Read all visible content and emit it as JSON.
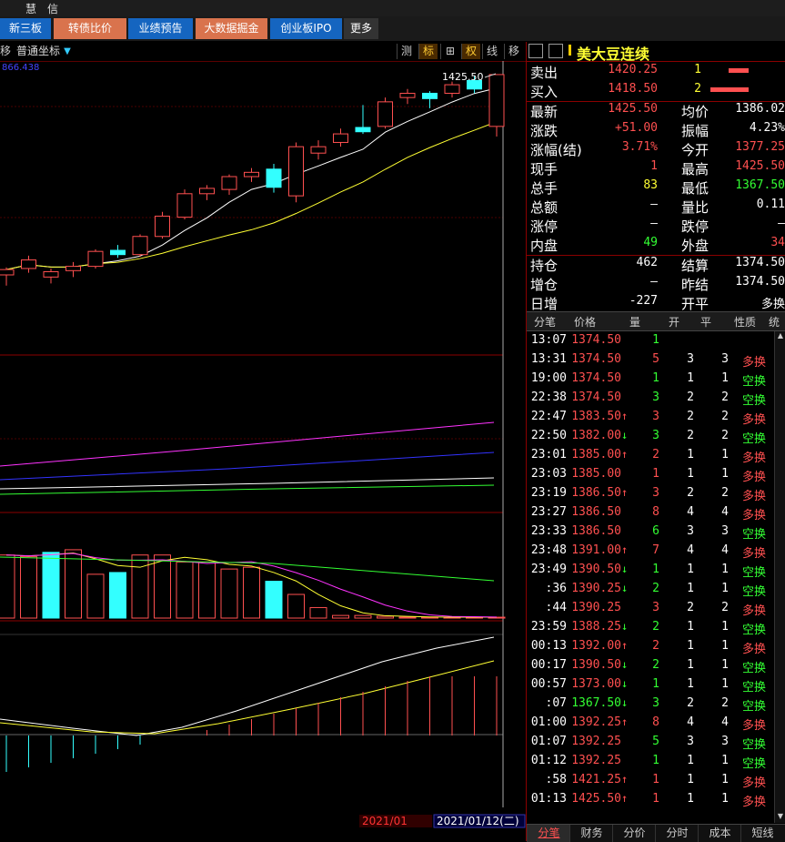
{
  "titlebar": {
    "left": "",
    "app_name_1": "慧",
    "app_name_2": "信"
  },
  "nav": {
    "tabs": [
      {
        "label": "新三板",
        "bg": "#1565c0"
      },
      {
        "label": "转债比价",
        "bg": "#d9734d"
      },
      {
        "label": "业绩预告",
        "bg": "#1565c0"
      },
      {
        "label": "大数据掘金",
        "bg": "#d9734d"
      },
      {
        "label": "创业板IPO",
        "bg": "#1565c0"
      },
      {
        "label": "更多",
        "bg": "#333333"
      }
    ]
  },
  "chart_toolbar": {
    "left_item": "移",
    "coord_mode": "普通坐标",
    "dropdown_arrow": "▼",
    "buttons": [
      "测",
      "标",
      "⊞",
      "权",
      "线",
      "移"
    ],
    "panel_icons": [
      "◻",
      "◼"
    ]
  },
  "chart": {
    "top_left_value": "866.438",
    "last_price_label": "1425.50",
    "dates": [
      "2021/01",
      "2021/01/12(二)"
    ]
  },
  "instrument": {
    "name": "美大豆连续"
  },
  "quotes": {
    "sell": {
      "label": "卖出",
      "price": "1420.25",
      "qty": "1"
    },
    "buy": {
      "label": "买入",
      "price": "1418.50",
      "qty": "2"
    },
    "rows": [
      {
        "l": "最新",
        "lv": "1425.50",
        "lc": "red",
        "r": "均价",
        "rv": "1386.02",
        "rc": "white"
      },
      {
        "l": "涨跌",
        "lv": "+51.00",
        "lc": "red",
        "r": "振幅",
        "rv": "4.23%",
        "rc": "white"
      },
      {
        "l": "涨幅(结)",
        "lv": "3.71%",
        "lc": "red",
        "r": "今开",
        "rv": "1377.25",
        "rc": "red"
      },
      {
        "l": "现手",
        "lv": "1",
        "lc": "red",
        "r": "最高",
        "rv": "1425.50",
        "rc": "red"
      },
      {
        "l": "总手",
        "lv": "83",
        "lc": "yellow",
        "r": "最低",
        "rv": "1367.50",
        "rc": "green"
      },
      {
        "l": "总额",
        "lv": "–",
        "lc": "white",
        "r": "量比",
        "rv": "0.11",
        "rc": "white"
      },
      {
        "l": "涨停",
        "lv": "–",
        "lc": "white",
        "r": "跌停",
        "rv": "–",
        "rc": "white"
      },
      {
        "l": "内盘",
        "lv": "49",
        "lc": "green",
        "r": "外盘",
        "rv": "34",
        "rc": "red"
      },
      {
        "l": "持仓",
        "lv": "462",
        "lc": "white",
        "r": "结算",
        "rv": "1374.50",
        "rc": "white"
      },
      {
        "l": "增仓",
        "lv": "–",
        "lc": "white",
        "r": "昨结",
        "rv": "1374.50",
        "rc": "white"
      },
      {
        "l": "日增",
        "lv": "-227",
        "lc": "white",
        "r": "开平",
        "rv": "多换",
        "rc": "white"
      }
    ]
  },
  "ticks": {
    "headers": [
      "分笔",
      "价格",
      "量",
      "开",
      "平",
      "性质",
      "统"
    ],
    "rows": [
      {
        "t": "13:07",
        "p": "1374.50",
        "pc": "red",
        "a": "",
        "v": "1",
        "vc": "green",
        "k": "",
        "pg": "",
        "n": "",
        "nc": "red"
      },
      {
        "t": "13:31",
        "p": "1374.50",
        "pc": "red",
        "a": "",
        "v": "5",
        "vc": "red",
        "k": "3",
        "pg": "3",
        "n": "多换",
        "nc": "red"
      },
      {
        "t": "19:00",
        "p": "1374.50",
        "pc": "red",
        "a": "",
        "v": "1",
        "vc": "green",
        "k": "1",
        "pg": "1",
        "n": "空换",
        "nc": "green"
      },
      {
        "t": "22:38",
        "p": "1374.50",
        "pc": "red",
        "a": "",
        "v": "3",
        "vc": "green",
        "k": "2",
        "pg": "2",
        "n": "空换",
        "nc": "green"
      },
      {
        "t": "22:47",
        "p": "1383.50",
        "pc": "red",
        "a": "↑",
        "v": "3",
        "vc": "red",
        "k": "2",
        "pg": "2",
        "n": "多换",
        "nc": "red"
      },
      {
        "t": "22:50",
        "p": "1382.00",
        "pc": "red",
        "a": "↓",
        "v": "3",
        "vc": "green",
        "k": "2",
        "pg": "2",
        "n": "空换",
        "nc": "green"
      },
      {
        "t": "23:01",
        "p": "1385.00",
        "pc": "red",
        "a": "↑",
        "v": "2",
        "vc": "red",
        "k": "1",
        "pg": "1",
        "n": "多换",
        "nc": "red"
      },
      {
        "t": "23:03",
        "p": "1385.00",
        "pc": "red",
        "a": "",
        "v": "1",
        "vc": "red",
        "k": "1",
        "pg": "1",
        "n": "多换",
        "nc": "red"
      },
      {
        "t": "23:19",
        "p": "1386.50",
        "pc": "red",
        "a": "↑",
        "v": "3",
        "vc": "red",
        "k": "2",
        "pg": "2",
        "n": "多换",
        "nc": "red"
      },
      {
        "t": "23:27",
        "p": "1386.50",
        "pc": "red",
        "a": "",
        "v": "8",
        "vc": "red",
        "k": "4",
        "pg": "4",
        "n": "多换",
        "nc": "red"
      },
      {
        "t": "23:33",
        "p": "1386.50",
        "pc": "red",
        "a": "",
        "v": "6",
        "vc": "green",
        "k": "3",
        "pg": "3",
        "n": "空换",
        "nc": "green"
      },
      {
        "t": "23:48",
        "p": "1391.00",
        "pc": "red",
        "a": "↑",
        "v": "7",
        "vc": "red",
        "k": "4",
        "pg": "4",
        "n": "多换",
        "nc": "red"
      },
      {
        "t": "23:49",
        "p": "1390.50",
        "pc": "red",
        "a": "↓",
        "v": "1",
        "vc": "green",
        "k": "1",
        "pg": "1",
        "n": "空换",
        "nc": "green"
      },
      {
        "t": ":36",
        "p": "1390.25",
        "pc": "red",
        "a": "↓",
        "v": "2",
        "vc": "green",
        "k": "1",
        "pg": "1",
        "n": "空换",
        "nc": "green"
      },
      {
        "t": ":44",
        "p": "1390.25",
        "pc": "red",
        "a": "",
        "v": "3",
        "vc": "red",
        "k": "2",
        "pg": "2",
        "n": "多换",
        "nc": "red"
      },
      {
        "t": "23:59",
        "p": "1388.25",
        "pc": "red",
        "a": "↓",
        "v": "2",
        "vc": "green",
        "k": "1",
        "pg": "1",
        "n": "空换",
        "nc": "green"
      },
      {
        "t": "00:13",
        "p": "1392.00",
        "pc": "red",
        "a": "↑",
        "v": "2",
        "vc": "red",
        "k": "1",
        "pg": "1",
        "n": "多换",
        "nc": "red"
      },
      {
        "t": "00:17",
        "p": "1390.50",
        "pc": "red",
        "a": "↓",
        "v": "2",
        "vc": "green",
        "k": "1",
        "pg": "1",
        "n": "空换",
        "nc": "green"
      },
      {
        "t": "00:57",
        "p": "1373.00",
        "pc": "red",
        "a": "↓",
        "v": "1",
        "vc": "green",
        "k": "1",
        "pg": "1",
        "n": "空换",
        "nc": "green"
      },
      {
        "t": ":07",
        "p": "1367.50",
        "pc": "green",
        "a": "↓",
        "v": "3",
        "vc": "green",
        "k": "2",
        "pg": "2",
        "n": "空换",
        "nc": "green"
      },
      {
        "t": "01:00",
        "p": "1392.25",
        "pc": "red",
        "a": "↑",
        "v": "8",
        "vc": "red",
        "k": "4",
        "pg": "4",
        "n": "多换",
        "nc": "red"
      },
      {
        "t": "01:07",
        "p": "1392.25",
        "pc": "red",
        "a": "",
        "v": "5",
        "vc": "green",
        "k": "3",
        "pg": "3",
        "n": "空换",
        "nc": "green"
      },
      {
        "t": "01:12",
        "p": "1392.25",
        "pc": "red",
        "a": "",
        "v": "1",
        "vc": "green",
        "k": "1",
        "pg": "1",
        "n": "空换",
        "nc": "green"
      },
      {
        "t": ":58",
        "p": "1421.25",
        "pc": "red",
        "a": "↑",
        "v": "1",
        "vc": "red",
        "k": "1",
        "pg": "1",
        "n": "多换",
        "nc": "red"
      },
      {
        "t": "01:13",
        "p": "1425.50",
        "pc": "red",
        "a": "↑",
        "v": "1",
        "vc": "red",
        "k": "1",
        "pg": "1",
        "n": "多换",
        "nc": "red"
      }
    ]
  },
  "bottom_tabs": [
    "分笔",
    "财务",
    "分价",
    "分时",
    "成本",
    "短线"
  ],
  "colors": {
    "up": "#ff5050",
    "down": "#33ffff",
    "grid": "#8b0000",
    "accent": "#1565c0"
  },
  "chart_data": {
    "type": "candlestick",
    "candles": [
      {
        "o": 1238,
        "h": 1245,
        "l": 1228,
        "c": 1243
      },
      {
        "o": 1244,
        "h": 1256,
        "l": 1240,
        "c": 1252
      },
      {
        "o": 1236,
        "h": 1244,
        "l": 1230,
        "c": 1241
      },
      {
        "o": 1242,
        "h": 1250,
        "l": 1236,
        "c": 1246
      },
      {
        "o": 1246,
        "h": 1262,
        "l": 1244,
        "c": 1260
      },
      {
        "o": 1261,
        "h": 1266,
        "l": 1254,
        "c": 1257
      },
      {
        "o": 1257,
        "h": 1276,
        "l": 1255,
        "c": 1274
      },
      {
        "o": 1274,
        "h": 1297,
        "l": 1272,
        "c": 1293
      },
      {
        "o": 1292,
        "h": 1318,
        "l": 1290,
        "c": 1314
      },
      {
        "o": 1314,
        "h": 1322,
        "l": 1308,
        "c": 1319
      },
      {
        "o": 1318,
        "h": 1332,
        "l": 1313,
        "c": 1330
      },
      {
        "o": 1330,
        "h": 1338,
        "l": 1325,
        "c": 1334
      },
      {
        "o": 1337,
        "h": 1342,
        "l": 1315,
        "c": 1320
      },
      {
        "o": 1312,
        "h": 1362,
        "l": 1306,
        "c": 1358
      },
      {
        "o": 1352,
        "h": 1364,
        "l": 1346,
        "c": 1358
      },
      {
        "o": 1362,
        "h": 1375,
        "l": 1358,
        "c": 1370
      },
      {
        "o": 1376,
        "h": 1397,
        "l": 1370,
        "c": 1372
      },
      {
        "o": 1377,
        "h": 1404,
        "l": 1375,
        "c": 1400
      },
      {
        "o": 1404,
        "h": 1412,
        "l": 1398,
        "c": 1408
      },
      {
        "o": 1408,
        "h": 1410,
        "l": 1394,
        "c": 1403
      },
      {
        "o": 1408,
        "h": 1419,
        "l": 1404,
        "c": 1416
      },
      {
        "o": 1420,
        "h": 1424,
        "l": 1408,
        "c": 1412
      },
      {
        "o": 1377,
        "h": 1425.5,
        "l": 1367.5,
        "c": 1425.5
      }
    ],
    "volume": [
      72,
      70,
      75,
      78,
      50,
      52,
      72,
      72,
      64,
      64,
      56,
      58,
      42,
      27,
      12,
      3,
      3,
      2,
      1,
      1,
      1,
      1,
      1
    ],
    "volume_color": [
      "up",
      "up",
      "down",
      "up",
      "up",
      "down",
      "up",
      "up",
      "up",
      "up",
      "up",
      "up",
      "down",
      "up",
      "up",
      "up",
      "up",
      "up",
      "up",
      "up",
      "up",
      "up",
      "up"
    ]
  }
}
